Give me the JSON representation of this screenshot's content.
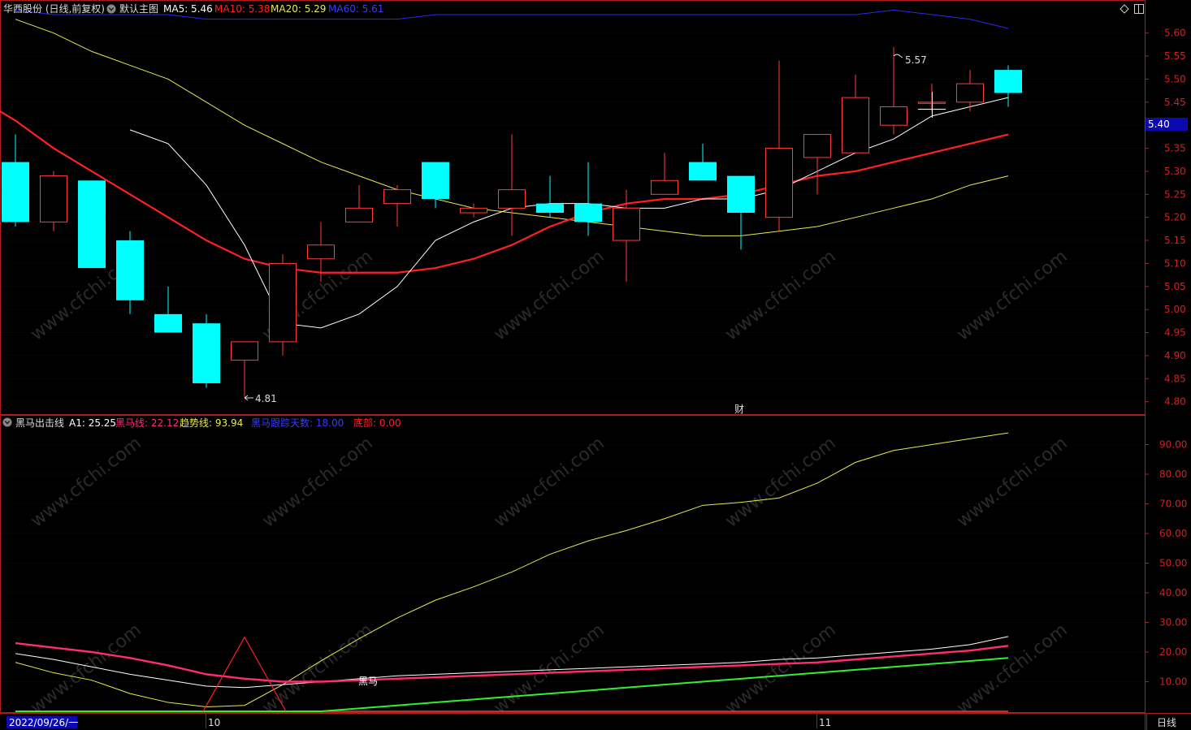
{
  "header": {
    "stock_name": "华西股份 (日线,前复权)",
    "main_chart": "默认主图",
    "ma5": "MA5: 5.46",
    "ma10": "MA10: 5.38",
    "ma20": "MA20: 5.29",
    "ma60": "MA60: 5.61"
  },
  "indicator_header": {
    "name": "黑马出击线",
    "a1": "A1: 25.25",
    "heima": "黑马线: 22.12",
    "trend": "趋势线: 93.94",
    "days": "黑马跟踪天数: 18.00",
    "bottom": "底部: 0.00"
  },
  "price_label": "5.40",
  "annotations": {
    "high": "5.57",
    "low": "4.81",
    "cai": "财",
    "heima_label": "黑马"
  },
  "axis": {
    "date_start": "2022/09/26/一",
    "month_10": "10",
    "month_11": "11",
    "period": "日线",
    "main_ticks": [
      "5.60",
      "5.55",
      "5.50",
      "5.45",
      "5.40",
      "5.35",
      "5.30",
      "5.25",
      "5.20",
      "5.15",
      "5.10",
      "5.05",
      "5.00",
      "4.95",
      "4.90",
      "4.85",
      "4.80"
    ],
    "ind_ticks": [
      "90.00",
      "80.00",
      "70.00",
      "60.00",
      "50.00",
      "40.00",
      "30.00",
      "20.00",
      "10.00"
    ]
  },
  "watermark": "www.cfchi.com",
  "colors": {
    "up": "#ff3c3c",
    "down": "#00ffff",
    "ma5": "#ffffff",
    "ma10": "#ff2020",
    "ma20": "#e8e850",
    "ma60": "#2a2af0",
    "frame": "#b01c1c",
    "heima": "#ff2d6e",
    "trend": "#e8e850",
    "days": "#33ee33"
  },
  "chart_data": [
    {
      "type": "candlestick",
      "title": "华西股份 (日线,前复权)",
      "ylim": [
        4.78,
        5.64
      ],
      "candles": [
        {
          "o": 5.32,
          "h": 5.38,
          "l": 5.18,
          "c": 5.19
        },
        {
          "o": 5.19,
          "h": 5.3,
          "l": 5.17,
          "c": 5.29
        },
        {
          "o": 5.28,
          "h": 5.28,
          "l": 5.09,
          "c": 5.09
        },
        {
          "o": 5.15,
          "h": 5.17,
          "l": 4.99,
          "c": 5.02
        },
        {
          "o": 4.99,
          "h": 5.05,
          "l": 4.95,
          "c": 4.95
        },
        {
          "o": 4.97,
          "h": 4.99,
          "l": 4.83,
          "c": 4.84
        },
        {
          "o": 4.89,
          "h": 4.93,
          "l": 4.81,
          "c": 4.93
        },
        {
          "o": 4.93,
          "h": 5.12,
          "l": 4.9,
          "c": 5.1
        },
        {
          "o": 5.11,
          "h": 5.19,
          "l": 5.06,
          "c": 5.14
        },
        {
          "o": 5.19,
          "h": 5.27,
          "l": 5.19,
          "c": 5.22
        },
        {
          "o": 5.23,
          "h": 5.27,
          "l": 5.18,
          "c": 5.26
        },
        {
          "o": 5.32,
          "h": 5.32,
          "l": 5.22,
          "c": 5.24
        },
        {
          "o": 5.21,
          "h": 5.23,
          "l": 5.2,
          "c": 5.22
        },
        {
          "o": 5.22,
          "h": 5.38,
          "l": 5.16,
          "c": 5.26
        },
        {
          "o": 5.23,
          "h": 5.29,
          "l": 5.2,
          "c": 5.21
        },
        {
          "o": 5.23,
          "h": 5.32,
          "l": 5.16,
          "c": 5.19
        },
        {
          "o": 5.15,
          "h": 5.26,
          "l": 5.06,
          "c": 5.22
        },
        {
          "o": 5.25,
          "h": 5.34,
          "l": 5.25,
          "c": 5.28
        },
        {
          "o": 5.32,
          "h": 5.36,
          "l": 5.28,
          "c": 5.28
        },
        {
          "o": 5.29,
          "h": 5.29,
          "l": 5.13,
          "c": 5.21
        },
        {
          "o": 5.2,
          "h": 5.54,
          "l": 5.17,
          "c": 5.35
        },
        {
          "o": 5.33,
          "h": 5.38,
          "l": 5.25,
          "c": 5.38
        },
        {
          "o": 5.34,
          "h": 5.51,
          "l": 5.34,
          "c": 5.46
        },
        {
          "o": 5.4,
          "h": 5.57,
          "l": 5.38,
          "c": 5.44
        },
        {
          "o": 5.45,
          "h": 5.49,
          "l": 5.43,
          "c": 5.45
        },
        {
          "o": 5.45,
          "h": 5.52,
          "l": 5.43,
          "c": 5.49
        },
        {
          "o": 5.52,
          "h": 5.53,
          "l": 5.44,
          "c": 5.47
        }
      ],
      "ma5": [
        5.39,
        5.36,
        5.27,
        5.14,
        4.97,
        4.96,
        4.99,
        5.05,
        5.15,
        5.19,
        5.22,
        5.23,
        5.23,
        5.22,
        5.22,
        5.24,
        5.24,
        5.26,
        5.3,
        5.34,
        5.37,
        5.42,
        5.44,
        5.46
      ],
      "ma10": [
        5.46,
        5.41,
        5.35,
        5.3,
        5.25,
        5.2,
        5.15,
        5.11,
        5.09,
        5.08,
        5.08,
        5.08,
        5.09,
        5.11,
        5.14,
        5.18,
        5.21,
        5.23,
        5.24,
        5.24,
        5.25,
        5.27,
        5.29,
        5.3,
        5.32,
        5.34,
        5.36,
        5.38
      ],
      "ma20": [
        5.63,
        5.6,
        5.56,
        5.53,
        5.5,
        5.45,
        5.4,
        5.36,
        5.32,
        5.29,
        5.26,
        5.24,
        5.22,
        5.21,
        5.2,
        5.19,
        5.18,
        5.17,
        5.16,
        5.16,
        5.17,
        5.18,
        5.2,
        5.22,
        5.24,
        5.27,
        5.29
      ],
      "ma60": [
        5.65,
        5.64,
        5.64,
        5.64,
        5.64,
        5.63,
        5.63,
        5.63,
        5.63,
        5.63,
        5.63,
        5.64,
        5.64,
        5.64,
        5.64,
        5.64,
        5.64,
        5.64,
        5.64,
        5.64,
        5.64,
        5.64,
        5.64,
        5.65,
        5.64,
        5.63,
        5.61
      ]
    },
    {
      "type": "line",
      "title": "黑马出击线",
      "ylim": [
        0,
        96
      ],
      "series": [
        {
          "name": "A1",
          "values": [
            19.5,
            17.5,
            15.0,
            12.5,
            10.5,
            8.5,
            8.0,
            9.0,
            10.0,
            11.0,
            12.0,
            12.5,
            13.0,
            13.5,
            14.0,
            14.5,
            15.0,
            15.5,
            16.0,
            16.5,
            17.5,
            18.0,
            19.0,
            20.0,
            21.0,
            22.5,
            25.25
          ]
        },
        {
          "name": "黑马线",
          "values": [
            23.0,
            21.5,
            20.0,
            18.0,
            15.5,
            12.5,
            11.0,
            10.0,
            10.0,
            10.5,
            11.0,
            11.5,
            12.0,
            12.5,
            13.0,
            13.5,
            14.0,
            14.5,
            15.0,
            15.5,
            16.0,
            16.5,
            17.5,
            18.5,
            19.5,
            20.5,
            22.12
          ]
        },
        {
          "name": "趋势线",
          "values": [
            16.5,
            13.0,
            10.5,
            6.0,
            3.0,
            1.5,
            2.0,
            9.0,
            17.0,
            24.5,
            31.5,
            37.5,
            42.0,
            47.0,
            53.0,
            57.5,
            61.0,
            65.0,
            69.5,
            70.5,
            72.0,
            77.0,
            84.0,
            88.0,
            90.0,
            92.0,
            93.94
          ]
        },
        {
          "name": "黑马跟踪天数",
          "values": [
            0,
            0,
            0,
            0,
            0,
            0,
            0,
            0,
            0,
            1,
            2,
            3,
            4,
            5,
            6,
            7,
            8,
            9,
            10,
            11,
            12,
            13,
            14,
            15,
            16,
            17,
            18
          ]
        },
        {
          "name": "底部",
          "values": [
            0,
            0,
            0,
            0,
            0,
            0,
            0,
            0,
            0,
            0,
            0,
            0,
            0,
            0,
            0,
            0,
            0,
            0,
            0,
            0,
            0,
            0,
            0,
            0,
            0,
            0,
            0
          ]
        }
      ]
    }
  ]
}
